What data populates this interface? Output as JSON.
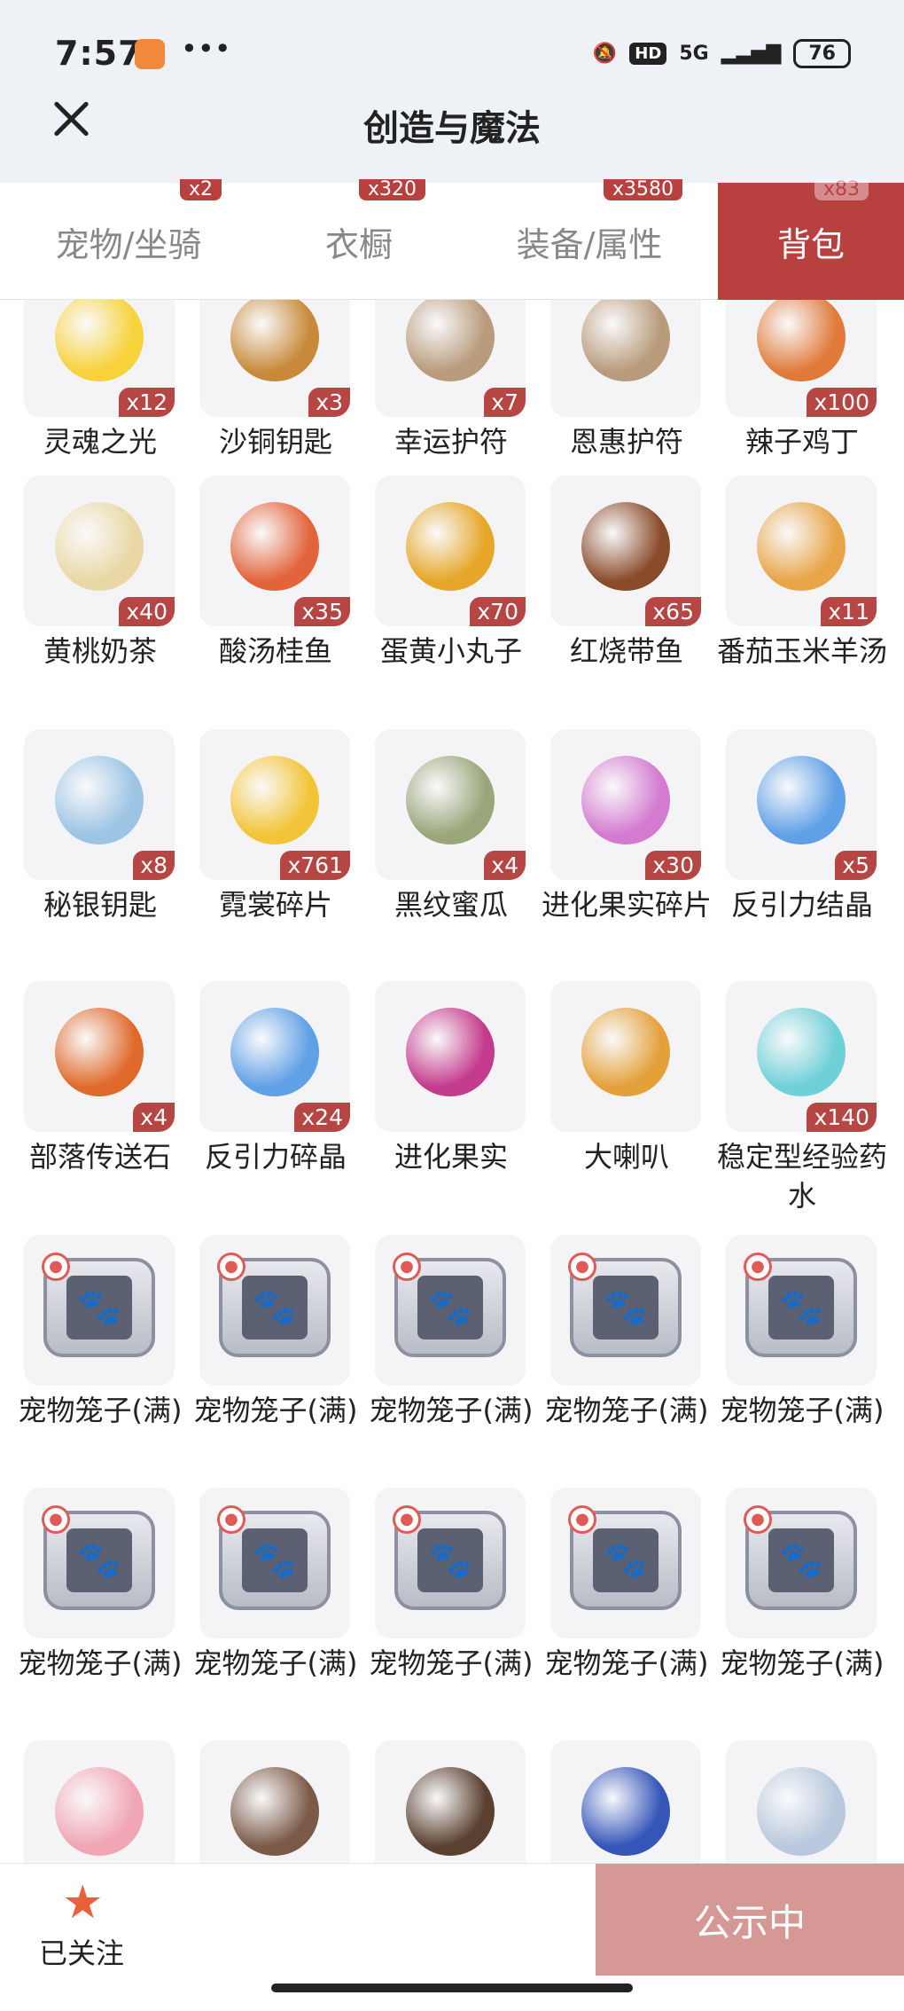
{
  "status": {
    "time": "7:57",
    "dots": "•••",
    "network": "5G",
    "hd": "HD",
    "battery": "76"
  },
  "header": {
    "title": "创造与魔法"
  },
  "tabs": [
    {
      "label": "宠物/坐骑",
      "count": "x2"
    },
    {
      "label": "衣橱",
      "count": "x320"
    },
    {
      "label": "装备/属性",
      "count": "x3580"
    },
    {
      "label": "背包",
      "count": "x83"
    }
  ],
  "items": [
    {
      "name": "灵魂之光",
      "qty": "x12",
      "color": "#f7d23a"
    },
    {
      "name": "沙铜钥匙",
      "qty": "x3",
      "color": "#c88a3a"
    },
    {
      "name": "幸运护符",
      "qty": "x7",
      "color": "#b89b7b"
    },
    {
      "name": "恩惠护符",
      "qty": "",
      "color": "#b89b7b"
    },
    {
      "name": "辣子鸡丁",
      "qty": "x100",
      "color": "#e07a3a"
    },
    {
      "name": "黄桃奶茶",
      "qty": "x40",
      "color": "#e9d8a6"
    },
    {
      "name": "酸汤桂鱼",
      "qty": "x35",
      "color": "#e2643b"
    },
    {
      "name": "蛋黄小丸子",
      "qty": "x70",
      "color": "#e6a627"
    },
    {
      "name": "红烧带鱼",
      "qty": "x65",
      "color": "#8a4b2b"
    },
    {
      "name": "番茄玉米羊汤",
      "qty": "x11",
      "color": "#e8a548"
    },
    {
      "name": "秘银钥匙",
      "qty": "x8",
      "color": "#9cc4e4"
    },
    {
      "name": "霓裳碎片",
      "qty": "x761",
      "color": "#f2c437"
    },
    {
      "name": "黑纹蜜瓜",
      "qty": "x4",
      "color": "#9aa67a"
    },
    {
      "name": "进化果实碎片",
      "qty": "x30",
      "color": "#d47ad0"
    },
    {
      "name": "反引力结晶",
      "qty": "x5",
      "color": "#5fa0e6"
    },
    {
      "name": "部落传送石",
      "qty": "x4",
      "color": "#e06a2b"
    },
    {
      "name": "反引力碎晶",
      "qty": "x24",
      "color": "#5fa0e6"
    },
    {
      "name": "进化果实",
      "qty": "",
      "color": "#c43a8c"
    },
    {
      "name": "大喇叭",
      "qty": "",
      "color": "#e4a13a"
    },
    {
      "name": "稳定型经验药水",
      "qty": "x140",
      "color": "#6fd0d8"
    },
    {
      "name": "宠物笼子(满)",
      "qty": "",
      "cage": true
    },
    {
      "name": "宠物笼子(满)",
      "qty": "",
      "cage": true
    },
    {
      "name": "宠物笼子(满)",
      "qty": "",
      "cage": true
    },
    {
      "name": "宠物笼子(满)",
      "qty": "",
      "cage": true
    },
    {
      "name": "宠物笼子(满)",
      "qty": "",
      "cage": true
    },
    {
      "name": "宠物笼子(满)",
      "qty": "",
      "cage": true
    },
    {
      "name": "宠物笼子(满)",
      "qty": "",
      "cage": true
    },
    {
      "name": "宠物笼子(满)",
      "qty": "",
      "cage": true
    },
    {
      "name": "宠物笼子(满)",
      "qty": "",
      "cage": true
    },
    {
      "name": "宠物笼子(满)",
      "qty": "",
      "cage": true
    },
    {
      "name": "",
      "qty": "",
      "color": "#f0a6b4"
    },
    {
      "name": "",
      "qty": "",
      "color": "#7b5a48"
    },
    {
      "name": "",
      "qty": "",
      "color": "#5a4030"
    },
    {
      "name": "",
      "qty": "",
      "color": "#3556b8"
    },
    {
      "name": "",
      "qty": "",
      "color": "#b9c8dc"
    }
  ],
  "bottom": {
    "follow_icon": "★",
    "follow_label": "已关注",
    "public_label": "公示中"
  }
}
